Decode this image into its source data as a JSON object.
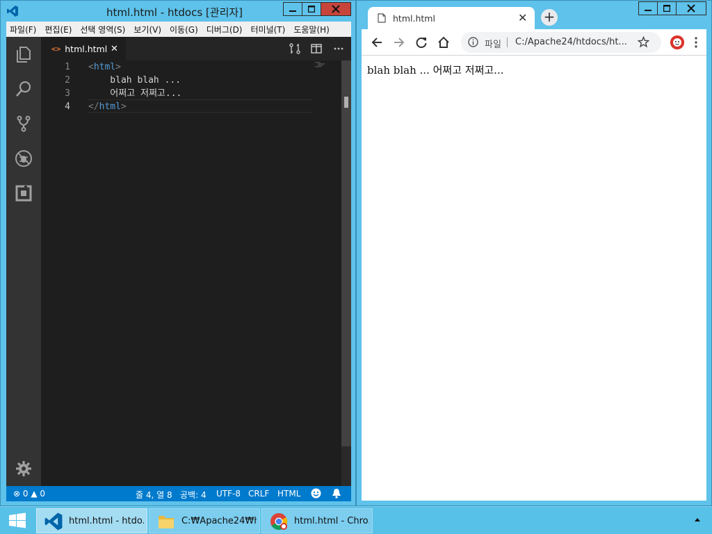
{
  "vscode": {
    "title": "html.html - htdocs [관리자]",
    "menu": [
      "파일(F)",
      "편집(E)",
      "선택 영역(S)",
      "보기(V)",
      "이동(G)",
      "디버그(D)",
      "터미널(T)",
      "도움말(H)"
    ],
    "tab": {
      "label": "html.html",
      "icon": "<>"
    },
    "code_lines": [
      {
        "number": "1",
        "indent": "",
        "open": "<",
        "tag": "html",
        "close": ">",
        "text": ""
      },
      {
        "number": "2",
        "text": "    blah blah ..."
      },
      {
        "number": "3",
        "text": "    어쩌고 저쩌고..."
      },
      {
        "number": "4",
        "indent": "",
        "open": "</",
        "tag": "html",
        "close": ">",
        "text": ""
      }
    ],
    "active_line": "4",
    "status": {
      "errors": "0",
      "warnings": "0",
      "position": "줄 4, 열 8",
      "spaces": "공백: 4",
      "encoding": "UTF-8",
      "eol": "CRLF",
      "language": "HTML"
    },
    "colors": {
      "statusbar": "#007acc",
      "editor_bg": "#1e1e1e",
      "tag": "#569cd6"
    }
  },
  "chrome": {
    "tab_title": "html.html",
    "new_tab": "+",
    "protocol": "파일",
    "url": "C:/Apache24/htdocs/ht...",
    "page_text": "blah blah ... 어쩌고 저쩌고..."
  },
  "taskbar": {
    "buttons": [
      {
        "label": "html.html - htdo...",
        "icon": "vscode-icon"
      },
      {
        "label": "C:₩Apache24₩ht...",
        "icon": "folder-icon"
      },
      {
        "label": "html.html - Chro...",
        "icon": "chrome-icon"
      }
    ]
  }
}
